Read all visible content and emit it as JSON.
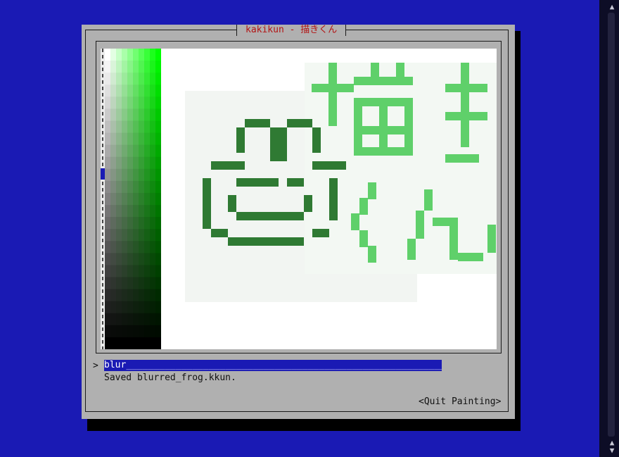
{
  "dialog": {
    "title": "kakikun - 描きくん"
  },
  "command": {
    "prompt": ">",
    "value": "blur",
    "fill": "____________________________________________________________"
  },
  "status_message": "Saved blurred_frog.kkun.",
  "quit_button_label": "<Quit Painting>",
  "colors": {
    "background": "#1a1ab4",
    "dialog": "#b0b0b0",
    "title_text": "#b21414",
    "frog": "#2f7a33",
    "kanji": "#5fd06a",
    "palette_green": "#00ff00"
  },
  "icons": {
    "scroll_up": "caret-up-icon",
    "scroll_down": "caret-down-icon"
  }
}
